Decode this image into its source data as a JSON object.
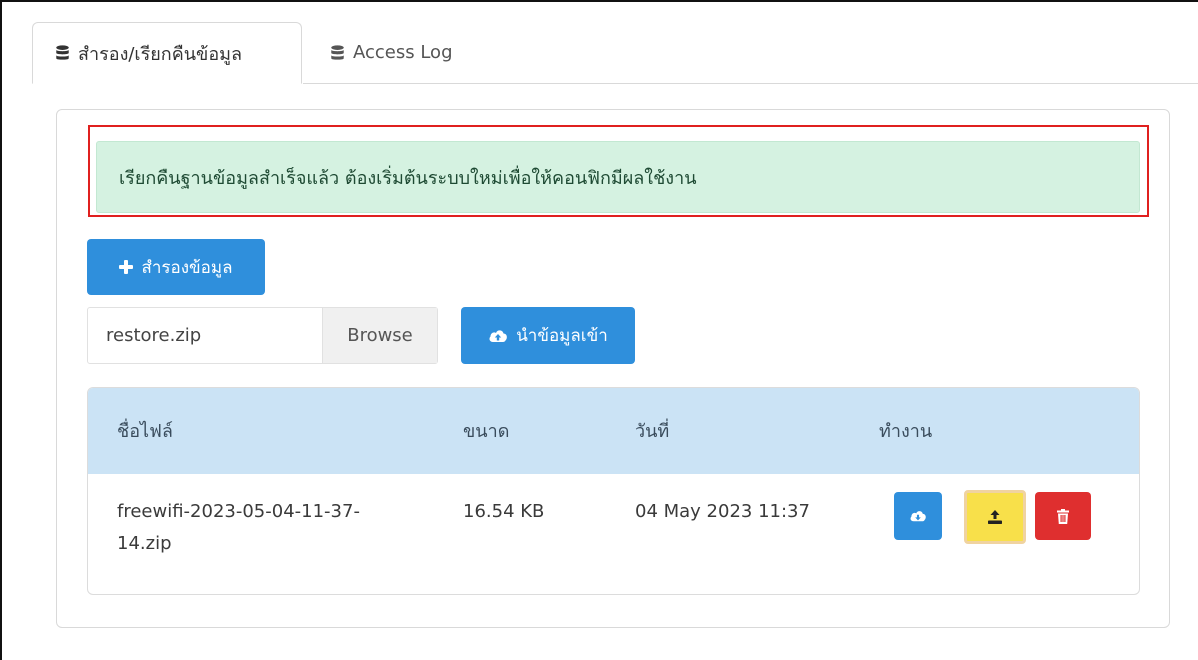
{
  "tabs": [
    {
      "label": "สำรอง/เรียกคืนข้อมูล",
      "icon": "database-icon",
      "active": true
    },
    {
      "label": "Access Log",
      "icon": "database-icon",
      "active": false
    }
  ],
  "alert": {
    "message": "เรียกคืนฐานข้อมูลสำเร็จแล้ว ต้องเริ่มต้นระบบใหม่เพื่อให้คอนฟิกมีผลใช้งาน"
  },
  "backup_button": {
    "label": "สำรองข้อมูล",
    "icon": "plus-icon"
  },
  "restore_file": {
    "value": "restore.zip",
    "browse_label": "Browse"
  },
  "import_button": {
    "label": "นำข้อมูลเข้า",
    "icon": "cloud-upload-icon"
  },
  "table": {
    "headers": [
      "ชื่อไฟล์",
      "ขนาด",
      "วันที่",
      "ทำงาน"
    ],
    "rows": [
      {
        "filename_line1": "freewifi-2023-05-04-11-37-",
        "filename_line2": "14.zip",
        "size": "16.54 KB",
        "date": "04 May 2023 11:37"
      }
    ]
  },
  "colors": {
    "primary": "#2f8fdc",
    "success_bg": "#d5f2e1",
    "warning": "#f8e04a",
    "danger": "#df2f2f",
    "highlight": "#e0201f",
    "table_header": "#cbe3f5"
  }
}
